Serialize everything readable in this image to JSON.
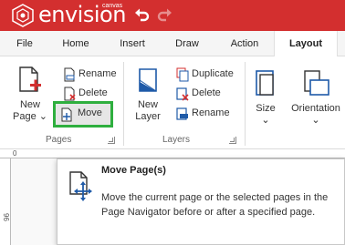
{
  "app": {
    "brand": "envision",
    "brand_sub": "canvas"
  },
  "menu": {
    "tabs": [
      {
        "label": "File"
      },
      {
        "label": "Home"
      },
      {
        "label": "Insert"
      },
      {
        "label": "Draw"
      },
      {
        "label": "Action"
      },
      {
        "label": "Layout",
        "active": true
      }
    ]
  },
  "ribbon": {
    "pages_group": {
      "label": "Pages",
      "new_page_label_1": "New",
      "new_page_label_2": "Page",
      "rename": "Rename",
      "delete": "Delete",
      "move": "Move"
    },
    "layers_group": {
      "label": "Layers",
      "new_layer_label_1": "New",
      "new_layer_label_2": "Layer",
      "duplicate": "Duplicate",
      "delete": "Delete",
      "rename": "Rename"
    },
    "size": {
      "label": "Size"
    },
    "orientation": {
      "label": "Orientation"
    }
  },
  "ruler": {
    "h_mark": "0",
    "v_mark": "96"
  },
  "tooltip": {
    "title": "Move Page(s)",
    "body": "Move the current page or the selected pages in the Page Navigator before or after a specified page."
  },
  "colors": {
    "brand_red": "#d32f2f",
    "highlight_green": "#2eaf3e",
    "icon_blue": "#1e5aa8"
  }
}
